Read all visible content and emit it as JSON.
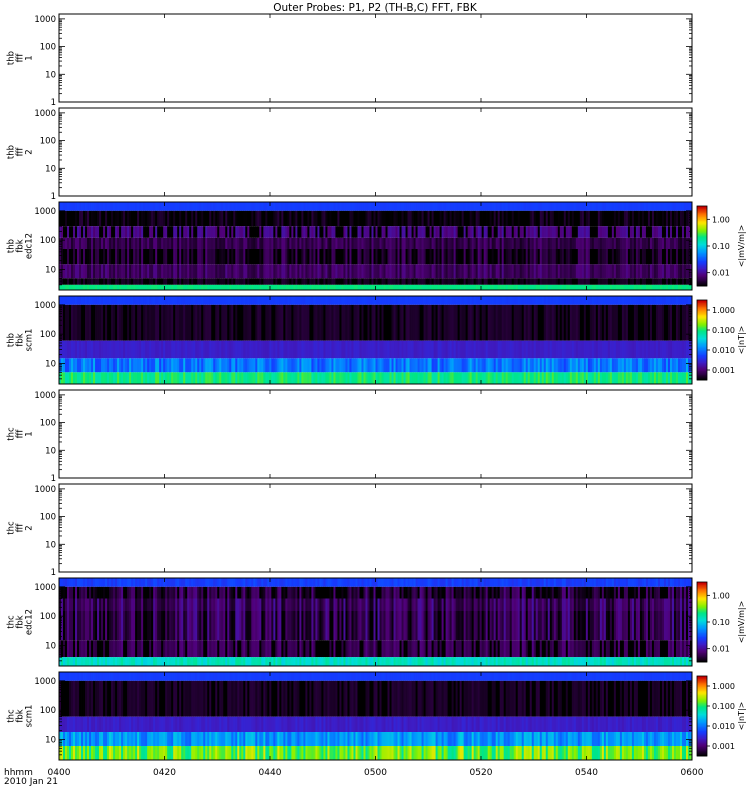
{
  "title": "Outer Probes: P1, P2 (TH-B,C) FFT, FBK",
  "colors": {
    "background": "#ffffff",
    "axis": "#000000"
  },
  "chart_data": [
    {
      "type": "heatmap",
      "ylabel": [
        "thb",
        "fff",
        "1"
      ],
      "yticks": [
        "1",
        "10",
        "100",
        "1000"
      ],
      "ylim": [
        1,
        1500
      ],
      "yscale": "log",
      "empty": true,
      "colorbar": null
    },
    {
      "type": "heatmap",
      "ylabel": [
        "thb",
        "fff",
        "2"
      ],
      "yticks": [
        "1",
        "10",
        "100",
        "1000"
      ],
      "ylim": [
        1,
        1500
      ],
      "yscale": "log",
      "empty": true,
      "colorbar": null
    },
    {
      "type": "heatmap",
      "ylabel": [
        "thb",
        "fbk",
        "edc12"
      ],
      "yticks": [
        "10",
        "100",
        "1000"
      ],
      "ylim": [
        2,
        2000
      ],
      "yscale": "log",
      "empty": false,
      "bands": [
        {
          "lo": 1000,
          "hi": 2000,
          "level": 0.3,
          "var": 0.01,
          "base": "const"
        },
        {
          "lo": 300,
          "hi": 1000,
          "level": 0.0008,
          "var": 0.12,
          "base": "const"
        },
        {
          "lo": 120,
          "hi": 300,
          "level": 0.12,
          "var": 0.06,
          "base": "dark"
        },
        {
          "lo": 50,
          "hi": 120,
          "level": 0.08,
          "var": 0.05,
          "base": "mid"
        },
        {
          "lo": 15,
          "hi": 50,
          "level": 0.001,
          "var": 0.12,
          "base": "dark"
        },
        {
          "lo": 5,
          "hi": 15,
          "level": 0.1,
          "var": 0.05,
          "base": "mid"
        },
        {
          "lo": 3,
          "hi": 5,
          "level": 0.02,
          "var": 0.03,
          "base": "dark"
        },
        {
          "lo": 2,
          "hi": 3,
          "level": 0.62,
          "var": 0.02,
          "base": "const"
        }
      ],
      "colorbar": {
        "label": "<|mV/m|>",
        "ticks": [
          "0.01",
          "0.10",
          "1.00"
        ]
      }
    },
    {
      "type": "heatmap",
      "ylabel": [
        "thb",
        "fbk",
        "scm1"
      ],
      "yticks": [
        "10",
        "100",
        "1000"
      ],
      "ylim": [
        2,
        2000
      ],
      "yscale": "log",
      "empty": false,
      "bands": [
        {
          "lo": 1000,
          "hi": 2000,
          "level": 0.3,
          "var": 0.01,
          "base": "const"
        },
        {
          "lo": 60,
          "hi": 1000,
          "level": 0.03,
          "var": 0.03,
          "base": "dark"
        },
        {
          "lo": 15,
          "hi": 60,
          "level": 0.22,
          "var": 0.03,
          "base": "const"
        },
        {
          "lo": 5,
          "hi": 15,
          "level": 0.38,
          "var": 0.08,
          "base": "mid"
        },
        {
          "lo": 2,
          "hi": 5,
          "level": 0.62,
          "var": 0.05,
          "base": "mid"
        }
      ],
      "colorbar": {
        "label": "<|nT|>",
        "ticks": [
          "0.001",
          "0.010",
          "0.100",
          "1.000"
        ]
      }
    },
    {
      "type": "heatmap",
      "ylabel": [
        "thc",
        "fff",
        "1"
      ],
      "yticks": [
        "1",
        "10",
        "100",
        "1000"
      ],
      "ylim": [
        1,
        1500
      ],
      "yscale": "log",
      "empty": true,
      "colorbar": null
    },
    {
      "type": "heatmap",
      "ylabel": [
        "thc",
        "fff",
        "2"
      ],
      "yticks": [
        "1",
        "10",
        "100",
        "1000"
      ],
      "ylim": [
        1,
        1500
      ],
      "yscale": "log",
      "empty": true,
      "colorbar": null
    },
    {
      "type": "heatmap",
      "ylabel": [
        "thc",
        "fbk",
        "edc12"
      ],
      "yticks": [
        "10",
        "100",
        "1000"
      ],
      "ylim": [
        2,
        2000
      ],
      "yscale": "log",
      "empty": false,
      "bands": [
        {
          "lo": 1000,
          "hi": 2000,
          "level": 0.3,
          "var": 0.05,
          "base": "const"
        },
        {
          "lo": 400,
          "hi": 1000,
          "level": 0.0008,
          "var": 0.15,
          "base": "dark"
        },
        {
          "lo": 150,
          "hi": 400,
          "level": 0.1,
          "var": 0.08,
          "base": "mid"
        },
        {
          "lo": 15,
          "hi": 150,
          "level": 0.08,
          "var": 0.1,
          "base": "mid"
        },
        {
          "lo": 4,
          "hi": 15,
          "level": 0.06,
          "var": 0.08,
          "base": "dark"
        },
        {
          "lo": 2,
          "hi": 4,
          "level": 0.55,
          "var": 0.05,
          "base": "mid"
        }
      ],
      "colorbar": {
        "label": "<|mV/m|>",
        "ticks": [
          "0.01",
          "0.10",
          "1.00"
        ]
      }
    },
    {
      "type": "heatmap",
      "ylabel": [
        "thc",
        "fbk",
        "scm1"
      ],
      "yticks": [
        "10",
        "100",
        "1000"
      ],
      "ylim": [
        2,
        2000
      ],
      "yscale": "log",
      "empty": false,
      "bands": [
        {
          "lo": 1000,
          "hi": 2000,
          "level": 0.3,
          "var": 0.01,
          "base": "const"
        },
        {
          "lo": 60,
          "hi": 1000,
          "level": 0.03,
          "var": 0.03,
          "base": "dark"
        },
        {
          "lo": 18,
          "hi": 60,
          "level": 0.22,
          "var": 0.04,
          "base": "const"
        },
        {
          "lo": 6,
          "hi": 18,
          "level": 0.42,
          "var": 0.08,
          "base": "mid"
        },
        {
          "lo": 2,
          "hi": 6,
          "level": 0.68,
          "var": 0.1,
          "base": "mid"
        }
      ],
      "colorbar": {
        "label": "<|nT|>",
        "ticks": [
          "0.001",
          "0.010",
          "0.100",
          "1.000"
        ]
      }
    }
  ],
  "xaxis": {
    "label": "hhmm",
    "date": "2010 Jan 21",
    "ticks": [
      "0400",
      "0420",
      "0440",
      "0500",
      "0520",
      "0540",
      "0600"
    ],
    "xlim": [
      "0400",
      "0600"
    ]
  }
}
